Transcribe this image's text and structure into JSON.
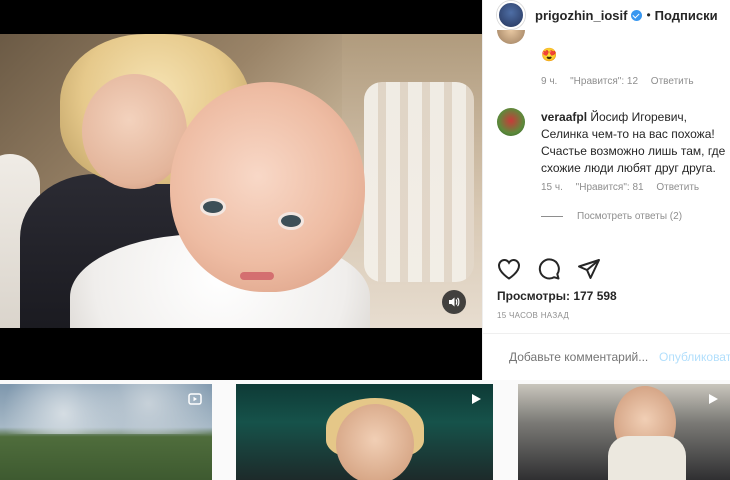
{
  "post_header": {
    "username": "prigozhin_iosif",
    "separator": "•",
    "follow_label": "Подписки"
  },
  "comments": [
    {
      "emoji": "😍",
      "time": "9 ч.",
      "likes": "\"Нравится\": 12",
      "reply": "Ответить"
    },
    {
      "username": "veraafpl",
      "text": "Йосиф Игоревич, Селинка чем-то на вас похожа! Счастье возможно лишь там, где схожие люди любят друг друга.",
      "time": "15 ч.",
      "likes": "\"Нравится\": 81",
      "reply": "Ответить",
      "view_replies": "Посмотреть ответы (2)"
    }
  ],
  "stats": {
    "views": "Просмотры: 177 598",
    "posted": "15 ЧАСОВ НАЗАД"
  },
  "add_comment": {
    "placeholder": "Добавьте комментарий...",
    "publish_label": "Опубликовать"
  },
  "icons": {
    "like": "heart-icon",
    "comment": "comment-bubble-icon",
    "share": "paper-plane-icon",
    "emoji": "smiley-icon",
    "sound": "speaker-icon",
    "thumb_badge": "video-icon"
  },
  "colors": {
    "accent": "#3897f0",
    "text": "#262626",
    "muted": "#8e8e8e"
  }
}
